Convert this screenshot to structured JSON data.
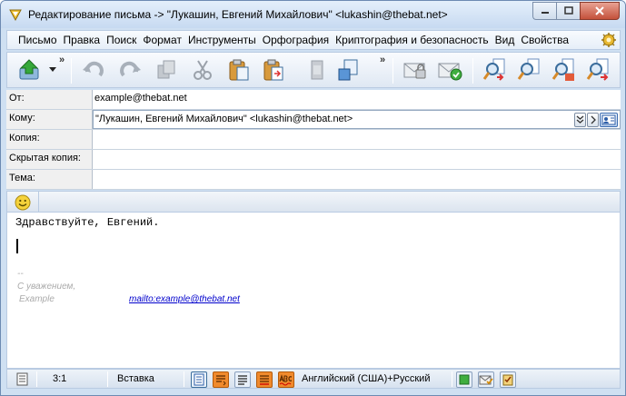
{
  "window": {
    "title": "Редактирование письма -> \"Лукашин, Евгений Михайлович\" <lukashin@thebat.net>"
  },
  "menu": [
    {
      "label": "Письмо"
    },
    {
      "label": "Правка"
    },
    {
      "label": "Поиск"
    },
    {
      "label": "Формат"
    },
    {
      "label": "Инструменты"
    },
    {
      "label": "Орфография"
    },
    {
      "label": "Криптография и безопасность"
    },
    {
      "label": "Вид"
    },
    {
      "label": "Свойства"
    }
  ],
  "toolbar": {
    "overflow_label": "»",
    "icons": [
      "send-icon",
      "undo-icon",
      "redo-icon",
      "copy-icon",
      "cut-icon",
      "paste-icon",
      "paste-special-icon",
      "delete-icon",
      "select-all-icon",
      "encrypt-icon",
      "sign-icon",
      "find-icon",
      "find-next-icon",
      "replace-icon",
      "find-prev-icon"
    ]
  },
  "headers": {
    "from": {
      "label": "От:",
      "value": "example@thebat.net"
    },
    "to": {
      "label": "Кому:",
      "value": "\"Лукашин, Евгений Михайлович\" <lukashin@thebat.net>"
    },
    "cc": {
      "label": "Копия:",
      "value": ""
    },
    "bcc": {
      "label": "Скрытая копия:",
      "value": ""
    },
    "subject": {
      "label": "Тема:",
      "value": ""
    }
  },
  "body": {
    "greeting": "Здравствуйте, Евгений.",
    "signature_dash": "--",
    "signature_regards": "С уважением,",
    "signature_name": "Example",
    "signature_link": "mailto:example@thebat.net"
  },
  "status": {
    "position": "3:1",
    "mode": "Вставка",
    "language": "Английский (США)+Русский"
  },
  "colors": {
    "frame": "#cfe0f2",
    "link": "#0000cc",
    "signature": "#aaaaaa"
  }
}
